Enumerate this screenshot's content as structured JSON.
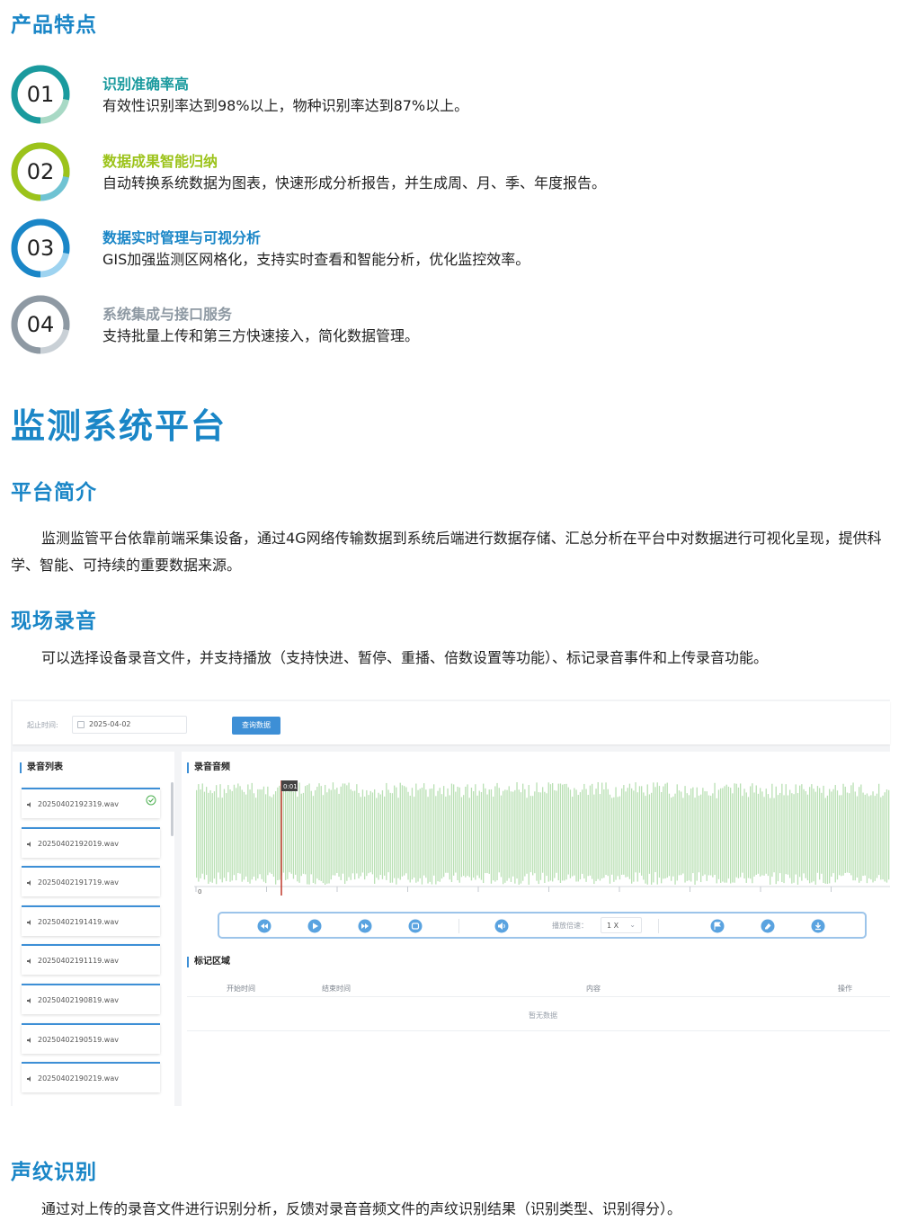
{
  "product_features": {
    "title": "产品特点",
    "items": [
      {
        "num": "01",
        "title": "识别准确率高",
        "desc": "有效性识别率达到98%以上，物种识别率达到87%以上。",
        "color": "#1a9a9e",
        "light": "#a8d9c5"
      },
      {
        "num": "02",
        "title": "数据成果智能归纳",
        "desc": "自动转换系统数据为图表，快速形成分析报告，并生成周、月、季、年度报告。",
        "color": "#9cc31a",
        "light": "#6fc3d3"
      },
      {
        "num": "03",
        "title": "数据实时管理与可视分析",
        "desc": "GIS加强监测区网格化，支持实时查看和智能分析，优化监控效率。",
        "color": "#1a86c7",
        "light": "#9ed3f0"
      },
      {
        "num": "04",
        "title": "系统集成与接口服务",
        "desc": "支持批量上传和第三方快速接入，简化数据管理。",
        "color": "#8e99a3",
        "light": "#c9d0d6"
      }
    ]
  },
  "platform": {
    "title": "监测系统平台",
    "intro_title": "平台简介",
    "intro_text": "监测监管平台依靠前端采集设备，通过4G网络传输数据到系统后端进行数据存储、汇总分析在平台中对数据进行可视化呈现，提供科学、智能、可持续的重要数据来源。",
    "recording_title": "现场录音",
    "recording_text": "可以选择设备录音文件，并支持播放（支持快进、暂停、重播、倍数设置等功能）、标记录音事件和上传录音功能。",
    "voiceprint_title": "声纹识别",
    "voiceprint_text": "通过对上传的录音文件进行识别分析，反馈对录音音频文件的声纹识别结果（识别类型、识别得分）。"
  },
  "app": {
    "filter_label": "起止时间:",
    "date_value": "2025-04-02",
    "query_button": "查询数据",
    "recording_list_title": "录音列表",
    "files": [
      "20250402192319.wav",
      "20250402192019.wav",
      "20250402191719.wav",
      "20250402191419.wav",
      "20250402191119.wav",
      "20250402190819.wav",
      "20250402190519.wav",
      "20250402190219.wav"
    ],
    "audio_title": "录音音频",
    "playhead_time": "0:01",
    "axis_zero": "0",
    "speed_label": "播放倍速：",
    "speed_value": "1 X",
    "mark_area_title": "标记区域",
    "table_headers": [
      "开始时间",
      "结束时间",
      "内容",
      "操作"
    ],
    "empty_text": "暂无数据",
    "accent_color": "#3d8fd6",
    "wave_color": "#b9e0b4",
    "playhead_color": "#c0392b"
  }
}
